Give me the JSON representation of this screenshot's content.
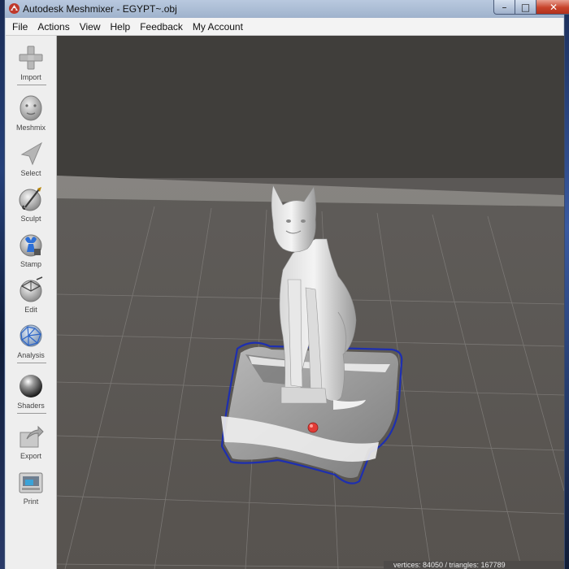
{
  "window": {
    "title": "Autodesk Meshmixer - EGYPT~.obj",
    "minimize_glyph": "–",
    "maximize_glyph": "□",
    "close_glyph": "✕"
  },
  "menubar": {
    "items": [
      "File",
      "Actions",
      "View",
      "Help",
      "Feedback",
      "My Account"
    ]
  },
  "toolbar": {
    "tools": [
      {
        "label": "Import",
        "icon": "plus-icon"
      },
      {
        "label": "Meshmix",
        "icon": "meshmix-head-icon"
      },
      {
        "label": "Select",
        "icon": "select-arrow-icon"
      },
      {
        "label": "Sculpt",
        "icon": "sculpt-brush-icon"
      },
      {
        "label": "Stamp",
        "icon": "stamp-icon"
      },
      {
        "label": "Edit",
        "icon": "edit-sphere-icon"
      },
      {
        "label": "Analysis",
        "icon": "analysis-sphere-icon"
      },
      {
        "label": "Shaders",
        "icon": "shader-ball-icon"
      },
      {
        "label": "Export",
        "icon": "export-icon"
      },
      {
        "label": "Print",
        "icon": "printer-icon"
      }
    ]
  },
  "viewport": {
    "model_name": "EGYPT~.obj",
    "status_text": "vertices: 84050 / triangles: 167789",
    "colors": {
      "background_top": "#403e3b",
      "background_floor": "#5b5856",
      "grid": "#7a7774",
      "selection_outline": "#1e2fb0",
      "pivot": "#e23b36"
    }
  }
}
